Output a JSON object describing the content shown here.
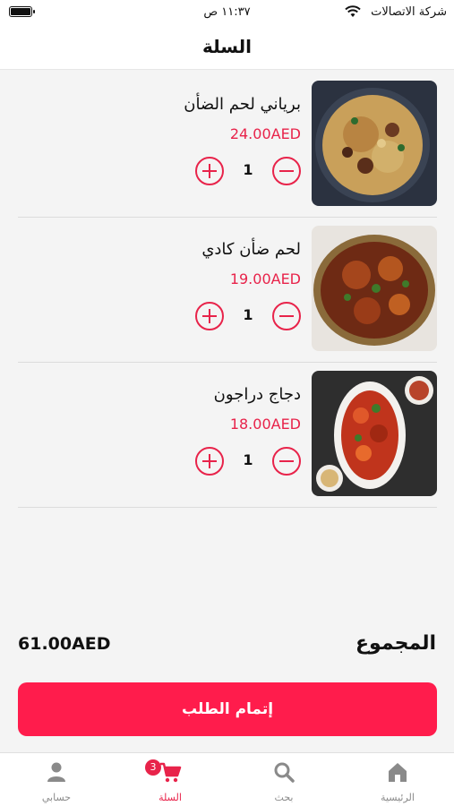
{
  "status_bar": {
    "carrier": "شركة الاتصالات",
    "time": "١١:٣٧ ص"
  },
  "header": {
    "title": "السلة"
  },
  "cart": {
    "items": [
      {
        "name": "برياني لحم الضأن",
        "price": "24.00AED",
        "quantity": "1",
        "image_icon": "lamb-biryani-photo"
      },
      {
        "name": "لحم ضأن كادي",
        "price": "19.00AED",
        "quantity": "1",
        "image_icon": "lamb-kadai-photo"
      },
      {
        "name": "دجاج دراجون",
        "price": "18.00AED",
        "quantity": "1",
        "image_icon": "dragon-chicken-photo"
      }
    ]
  },
  "summary": {
    "total_label": "المجموع",
    "total_value": "61.00AED",
    "checkout_label": "إتمام الطلب"
  },
  "bottom_nav": {
    "items": [
      {
        "label": "الرئيسية",
        "icon": "home-icon"
      },
      {
        "label": "بحث",
        "icon": "search-icon"
      },
      {
        "label": "السلة",
        "icon": "cart-icon",
        "badge": "3",
        "active": true
      },
      {
        "label": "حسابي",
        "icon": "user-icon"
      }
    ]
  },
  "colors": {
    "accent": "#e8234a",
    "checkout_bg": "#ff1c4c",
    "background": "#f4f4f4"
  }
}
